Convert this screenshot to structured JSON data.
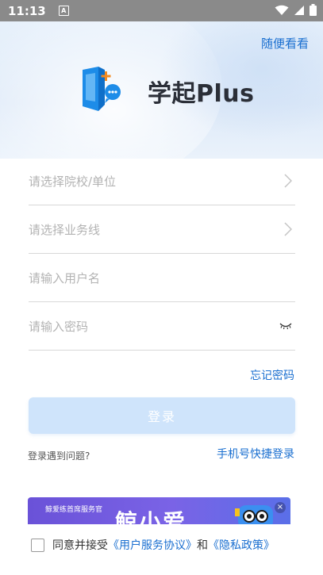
{
  "status": {
    "time": "11:13",
    "app_icon_letter": "A"
  },
  "header": {
    "skip_label": "随便看看",
    "brand": "学起Plus"
  },
  "form": {
    "school_placeholder": "请选择院校/单位",
    "business_placeholder": "请选择业务线",
    "username_placeholder": "请输入用户名",
    "password_placeholder": "请输入密码",
    "forgot_label": "忘记密码",
    "login_label": "登录",
    "problem_label": "登录遇到问题?",
    "sms_login_label": "手机号快捷登录"
  },
  "banner": {
    "tag": "鲸爱练首席服务官",
    "headline": "鲸小爱",
    "close": "×"
  },
  "agreement": {
    "prefix": "同意并接受",
    "user_agreement": "《用户服务协议》",
    "and": "和",
    "privacy_policy": "《隐私政策》"
  },
  "colors": {
    "accent": "#1a6fd0",
    "button_disabled": "#cfe4fb",
    "status_bar": "#8a8a8a"
  }
}
